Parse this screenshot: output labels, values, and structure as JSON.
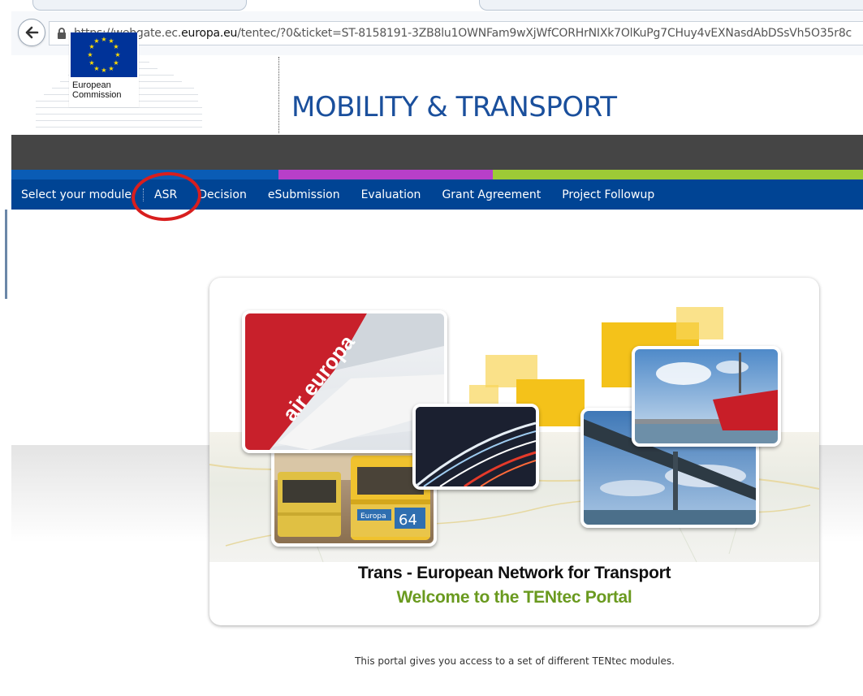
{
  "browser": {
    "url_prefix": "https://webgate.ec.",
    "url_domain": "europa.eu",
    "url_rest": "/tentec/?0&ticket=ST-8158191-3ZB8lu1OWNFam9wXjWfCORHrNIXk7OlKuPg7CHuy4vEXNasdAbDSsVh5O35r8c"
  },
  "header": {
    "logo_line1": "European",
    "logo_line2": "Commission",
    "site_title": "MOBILITY & TRANSPORT"
  },
  "nav": {
    "items": [
      {
        "label": "Select your module"
      },
      {
        "label": "ASR"
      },
      {
        "label": "Decision"
      },
      {
        "label": "eSubmission"
      },
      {
        "label": "Evaluation"
      },
      {
        "label": "Grant Agreement"
      },
      {
        "label": "Project Followup"
      }
    ]
  },
  "banner": {
    "airline_text": "air europa",
    "tram_sign": "Europa",
    "tram_number": "64",
    "title": "Trans - European Network for Transport",
    "subtitle": "Welcome to the TENtec Portal"
  },
  "intro_text": "This portal gives you access to a set of different TENtec modules.",
  "colors": {
    "nav_bg": "#004494",
    "title_blue": "#1a4f9c",
    "accent_green": "#6a9a1f",
    "highlight_red": "#d81e1e"
  }
}
